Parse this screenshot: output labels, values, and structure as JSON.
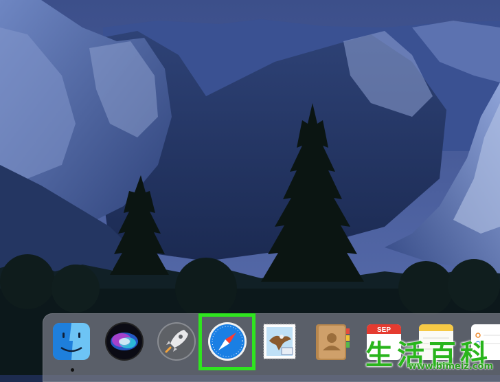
{
  "desktop": {
    "wallpaper": "yosemite-valley-dusk",
    "colors": {
      "sky": "#3f5a96",
      "cliff": "#5a74b0",
      "forest": "#0f1f22"
    }
  },
  "dock": {
    "items": [
      {
        "id": "finder",
        "icon": "finder-icon",
        "running": true
      },
      {
        "id": "siri",
        "icon": "siri-icon",
        "running": false
      },
      {
        "id": "launchpad",
        "icon": "rocket-icon",
        "running": false
      },
      {
        "id": "safari",
        "icon": "compass-icon",
        "running": false,
        "highlighted": true
      },
      {
        "id": "mail",
        "icon": "stamp-eagle-icon",
        "running": false
      },
      {
        "id": "contacts",
        "icon": "contacts-book-icon",
        "running": false
      },
      {
        "id": "calendar",
        "icon": "calendar-icon",
        "running": false,
        "month_label": "SEP"
      },
      {
        "id": "notes",
        "icon": "notes-icon",
        "running": false
      },
      {
        "id": "reminders",
        "icon": "reminders-icon",
        "running": false
      }
    ],
    "highlight_color": "#2fe51f"
  },
  "watermark": {
    "characters": "生活百科",
    "url": "www.bimeiz.com",
    "color": "#29b51c"
  }
}
